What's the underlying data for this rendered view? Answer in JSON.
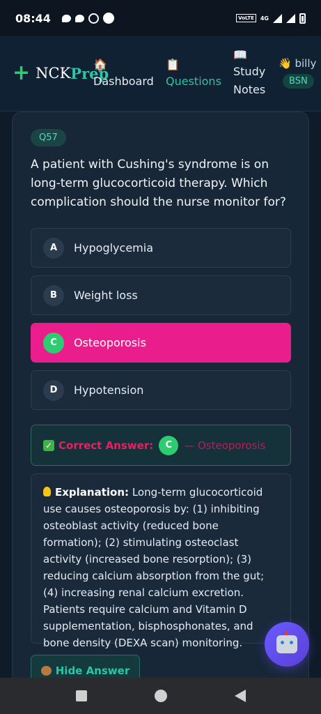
{
  "status_bar": {
    "time": "08:44",
    "volte": "VoLTE",
    "network": "4G"
  },
  "header": {
    "logo_prefix": "NCK",
    "logo_suffix": "Prep",
    "nav": [
      {
        "label": "Dashboard",
        "icon": "house-icon",
        "emoji": "🏠"
      },
      {
        "label": "Questions",
        "icon": "clipboard-icon",
        "emoji": "📋"
      },
      {
        "label": "Study\nNotes",
        "icon": "book-icon",
        "emoji": "📖"
      }
    ],
    "user_name": "billy",
    "user_emoji": "👋",
    "badge": "BSN"
  },
  "question": {
    "number": "Q57",
    "text": "A patient with Cushing's syndrome is on long-term glucocorticoid therapy. Which complication should the nurse monitor for?",
    "options": [
      {
        "letter": "A",
        "text": "Hypoglycemia",
        "selected": false
      },
      {
        "letter": "B",
        "text": "Weight loss",
        "selected": false
      },
      {
        "letter": "C",
        "text": "Osteoporosis",
        "selected": true
      },
      {
        "letter": "D",
        "text": "Hypotension",
        "selected": false
      }
    ]
  },
  "answer": {
    "label": "Correct Answer:",
    "letter": "C",
    "text": "— Osteoporosis"
  },
  "explanation": {
    "label": "Explanation:",
    "text": "Long-term glucocorticoid use causes osteoporosis by: (1) inhibiting osteoblast activity (reduced bone formation); (2) stimulating osteoclast activity (increased bone resorption); (3) reducing calcium absorption from the gut; (4) increasing renal calcium excretion. Patients require calcium and Vitamin D supplementation, bisphosphonates, and bone density (DEXA scan) monitoring."
  },
  "hide_button": "Hide Answer",
  "colors": {
    "accent": "#2ec4a4",
    "selected": "#e91e8c",
    "correct": "#2ecc71"
  }
}
